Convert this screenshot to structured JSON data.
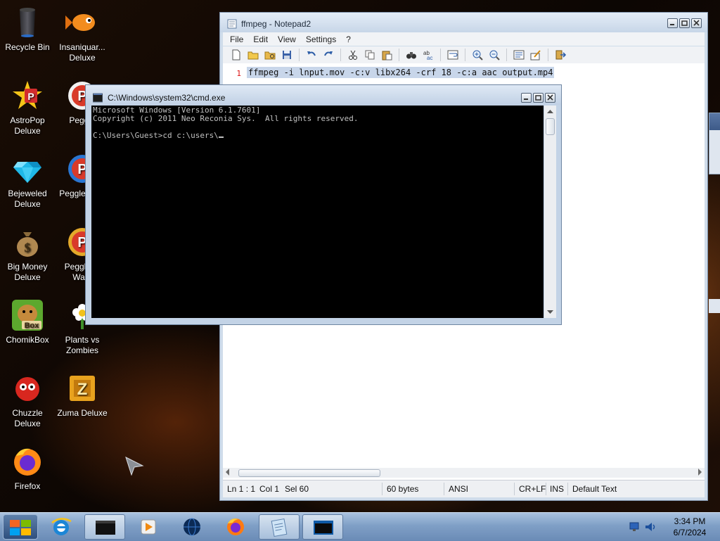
{
  "desktop": {
    "icons": [
      {
        "label": "Recycle Bin",
        "icon": "recycle-bin-icon"
      },
      {
        "label": "Insaniquar... Deluxe",
        "icon": "goldfish-icon"
      },
      {
        "label": "AstroPop Deluxe",
        "icon": "astropop-icon"
      },
      {
        "label": "Peggle",
        "icon": "peggle-icon"
      },
      {
        "label": "Bejeweled Deluxe",
        "icon": "diamond-icon"
      },
      {
        "label": "Peggle Delu",
        "icon": "peggle-icon"
      },
      {
        "label": "Big Money Deluxe",
        "icon": "money-bag-icon"
      },
      {
        "label": "Peggle of Warc",
        "icon": "peggle-icon"
      },
      {
        "label": "ChomikBox",
        "icon": "hamster-icon"
      },
      {
        "label": "Plants vs Zombies",
        "icon": "flower-icon"
      },
      {
        "label": "Chuzzle Deluxe",
        "icon": "chuzzle-icon"
      },
      {
        "label": "Zuma Deluxe",
        "icon": "zuma-icon"
      },
      {
        "label": "Firefox",
        "icon": "firefox-icon"
      }
    ]
  },
  "notepad": {
    "title": "ffmpeg - Notepad2",
    "menu": [
      "File",
      "Edit",
      "View",
      "Settings",
      "?"
    ],
    "line_number": "1",
    "content": "ffmpeg -i lnput.mov -c:v libx264 -crf 18 -c:a aac output.mp4",
    "status": {
      "position": "Ln 1 : 1",
      "column": "Col 1",
      "selection": "Sel 60",
      "size": "60 bytes",
      "encoding": "ANSI",
      "line_endings": "CR+LF",
      "insert_mode": "INS",
      "scheme": "Default Text"
    }
  },
  "cmd": {
    "title": "C:\\Windows\\system32\\cmd.exe",
    "lines": [
      "Microsoft Windows [Version 6.1.7601]",
      "Copyright (c) 2011 Neo Reconia Sys.  All rights reserved.",
      "",
      "C:\\Users\\Guest>cd c:\\users\\"
    ]
  },
  "taskbar": {
    "clock_time": "3:34 PM",
    "clock_date": "6/7/2024",
    "pinned": [
      "start-orb-icon",
      "internet-explorer-icon",
      "terminal-window-icon",
      "media-player-icon",
      "globe-icon",
      "firefox-icon",
      "notepad-icon",
      "cmd-icon"
    ]
  },
  "colors": {
    "accent": "#3d5a88",
    "selection": "#c8d6ea",
    "line_number": "#dd1111"
  }
}
